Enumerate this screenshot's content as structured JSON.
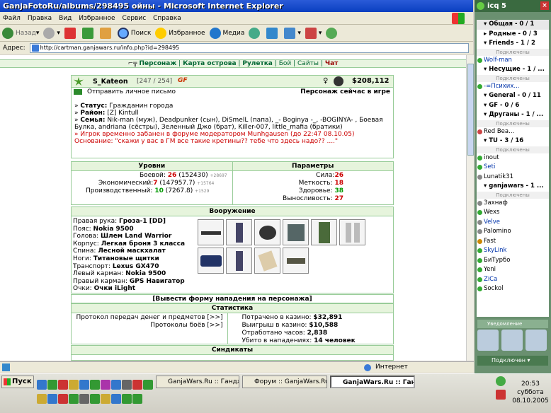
{
  "ie": {
    "title": "GanjaFotoRu/albums/298495 ойны - Microsoft Internet Explorer",
    "menu": [
      "Файл",
      "Правка",
      "Вид",
      "Избранное",
      "Сервис",
      "Справка"
    ],
    "toolbar": {
      "back": "Назад",
      "search": "Поиск",
      "favorites": "Избранное",
      "media": "Медиа"
    },
    "address_label": "Адрес:",
    "address": "http://cartman.ganjawars.ru/info.php?id=298495",
    "status_zone": "Интернет"
  },
  "page": {
    "nav": [
      "Персонаж",
      "Карта острова",
      "Рулетка",
      "Бой",
      "Сайты",
      "Чат"
    ],
    "nav_sep": "|",
    "name": "S_Kateon",
    "hp": "[247 / 254]",
    "clan_tag": "GF",
    "money": "$208,112",
    "send_mail": "Отправить личное письмо",
    "online": "Персонаж сейчас в игре",
    "status_label": "Статус:",
    "status_value": "Гражданин города",
    "district_label": "Район:",
    "district_value": "[Z] Kintull",
    "family_label": "Семья:",
    "family_value": "Nik-man (муж), Deadpunker (сын), DiSmelL (папа), _- Boginya -_, -BOGINYA- , Боевая Булка, andriana (сёстры), Зеленный Джо (брат), Killer-007, little_mafia (братики)",
    "ban_text": "Игрок временно забанен в форуме модератором Munhgausen (до 22:47 08.10.05)",
    "ban_reason": "Основание: \"скажи у вас в ГМ все такие кретины?? тебе что здесь надо?? ....\"",
    "levels_h": "Уровни",
    "params_h": "Параметры",
    "levels": [
      {
        "label": "Боевой:",
        "val": "26",
        "extra": "(152430)",
        "inc": "+28697"
      },
      {
        "label": "Экономический:",
        "val": "7",
        "extra": "(147957.7)",
        "inc": "+15764"
      },
      {
        "label": "Производственный:",
        "val": "10",
        "extra": "(7267.8)",
        "inc": "+1529"
      }
    ],
    "params": [
      {
        "label": "Сила:",
        "val": "26"
      },
      {
        "label": "Меткость:",
        "val": "18"
      },
      {
        "label": "Здоровье:",
        "val": "38"
      },
      {
        "label": "Выносливость:",
        "val": "27"
      }
    ],
    "weapons_h": "Вооружение",
    "weapons": [
      {
        "label": "Правая рука:",
        "val": "Гроза-1 [DD]"
      },
      {
        "label": "Пояс:",
        "val": "Nokia 9500"
      },
      {
        "label": "Голова:",
        "val": "Шлем Land Warrior"
      },
      {
        "label": "Корпус:",
        "val": "Легкая броня 3 класса"
      },
      {
        "label": "Спина:",
        "val": "Лесной маскхалат"
      },
      {
        "label": "Ноги:",
        "val": "Титановые щитки"
      },
      {
        "label": "Транспорт:",
        "val": "Lexus GX470"
      },
      {
        "label": "Левый карман:",
        "val": "Nokia 9500"
      },
      {
        "label": "Правый карман:",
        "val": "GPS Навигатор"
      },
      {
        "label": "Очки:",
        "val": "Очки iLight"
      }
    ],
    "attack_form": "[Вывести форму нападения на персонажа]",
    "stats_h": "Статистика",
    "protocol_items": "Протокол передач денег и предметов [>>]",
    "protocol_battles": "Протоколы боёв [>>]",
    "stats": [
      {
        "label": "Потрачено в казино:",
        "val": "$32,891"
      },
      {
        "label": "Выигрыш в казино:",
        "val": "$10,588"
      },
      {
        "label": "Отработано часов:",
        "val": "2,838"
      },
      {
        "label": "Убито в нападениях:",
        "val": "14 человек"
      }
    ],
    "syndicates_h": "Синдикаты"
  },
  "icq": {
    "title": "icq 5",
    "groups_top": [
      {
        "label": "Общая - 0 / 1"
      },
      {
        "label": "Родные - 0 / 3"
      },
      {
        "label": "Friends - 1 / 2"
      }
    ],
    "connected": "Подключены",
    "items": [
      {
        "t": "Wolf-man",
        "k": "c"
      },
      {
        "t": "Несущие - 1 / ...",
        "k": "g"
      },
      {
        "t": "Подключены",
        "k": "s"
      },
      {
        "t": "-=Психих...",
        "k": "c"
      },
      {
        "t": "General - 0 / 11",
        "k": "g"
      },
      {
        "t": "GF - 0 / 6",
        "k": "g"
      },
      {
        "t": "Друганы - 1 / ...",
        "k": "g"
      },
      {
        "t": "Подключены",
        "k": "s"
      },
      {
        "t": "Red Bea...",
        "k": "c"
      },
      {
        "t": "TU - 3 / 16",
        "k": "g"
      },
      {
        "t": "Подключены",
        "k": "s"
      },
      {
        "t": "inout",
        "k": "c"
      },
      {
        "t": "Seti",
        "k": "c"
      },
      {
        "t": "Lunatik31",
        "k": "c"
      },
      {
        "t": "ganjawars - 1 ...",
        "k": "g"
      },
      {
        "t": "Подключены",
        "k": "s"
      },
      {
        "t": "Захнаф",
        "k": "c"
      },
      {
        "t": "Wexs",
        "k": "c"
      },
      {
        "t": "Velve",
        "k": "c"
      },
      {
        "t": "Palomino",
        "k": "c"
      },
      {
        "t": "Fast",
        "k": "c"
      },
      {
        "t": "SkyLink",
        "k": "c"
      },
      {
        "t": "БиТурбо",
        "k": "c"
      },
      {
        "t": "Yeni",
        "k": "c"
      },
      {
        "t": "ZiCa",
        "k": "c"
      },
      {
        "t": "Sockol",
        "k": "c"
      }
    ],
    "notify": "Уведомление",
    "state": "Подключен"
  },
  "taskbar": {
    "start": "Пуск",
    "tasks": [
      "GanjaWars.Ru :: Гандж...",
      "Форум :: GanjaWars.Ru ...",
      "GanjaWars.Ru :: Гандж..."
    ],
    "time": "20:53",
    "day": "суббота",
    "date": "08.10.2005"
  }
}
